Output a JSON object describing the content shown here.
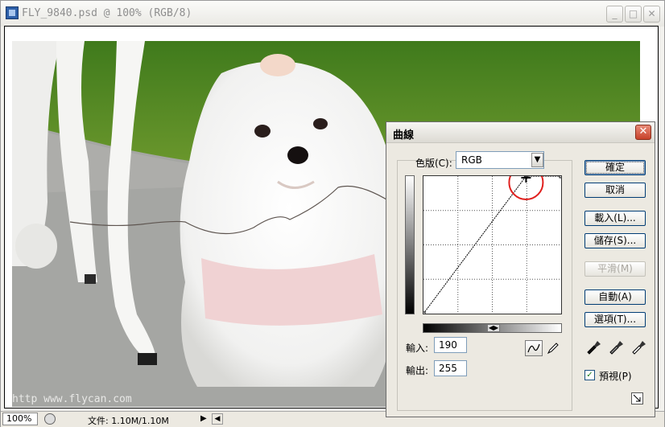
{
  "document": {
    "title": "FLY_9840.psd @ 100% (RGB/8)",
    "watermark": "http  www.flycan.com",
    "zoom": "100%",
    "status_text": "文件: 1.10M/1.10M"
  },
  "dialog": {
    "title": "曲線",
    "channel_label": "色版(C):",
    "channel_value": "RGB",
    "input_label": "輸入:",
    "input_value": "190",
    "output_label": "輸出:",
    "output_value": "255",
    "buttons": {
      "ok": "確定",
      "cancel": "取消",
      "load": "載入(L)...",
      "save": "儲存(S)...",
      "smooth": "平滑(M)",
      "auto": "自動(A)",
      "options": "選項(T)..."
    },
    "preview_label": "預視(P)",
    "preview_checked": true
  },
  "curve": {
    "points": [
      [
        0,
        0
      ],
      [
        190,
        255
      ],
      [
        255,
        255
      ]
    ],
    "grid_divisions": 4,
    "highlight_color": "#e0201e"
  }
}
